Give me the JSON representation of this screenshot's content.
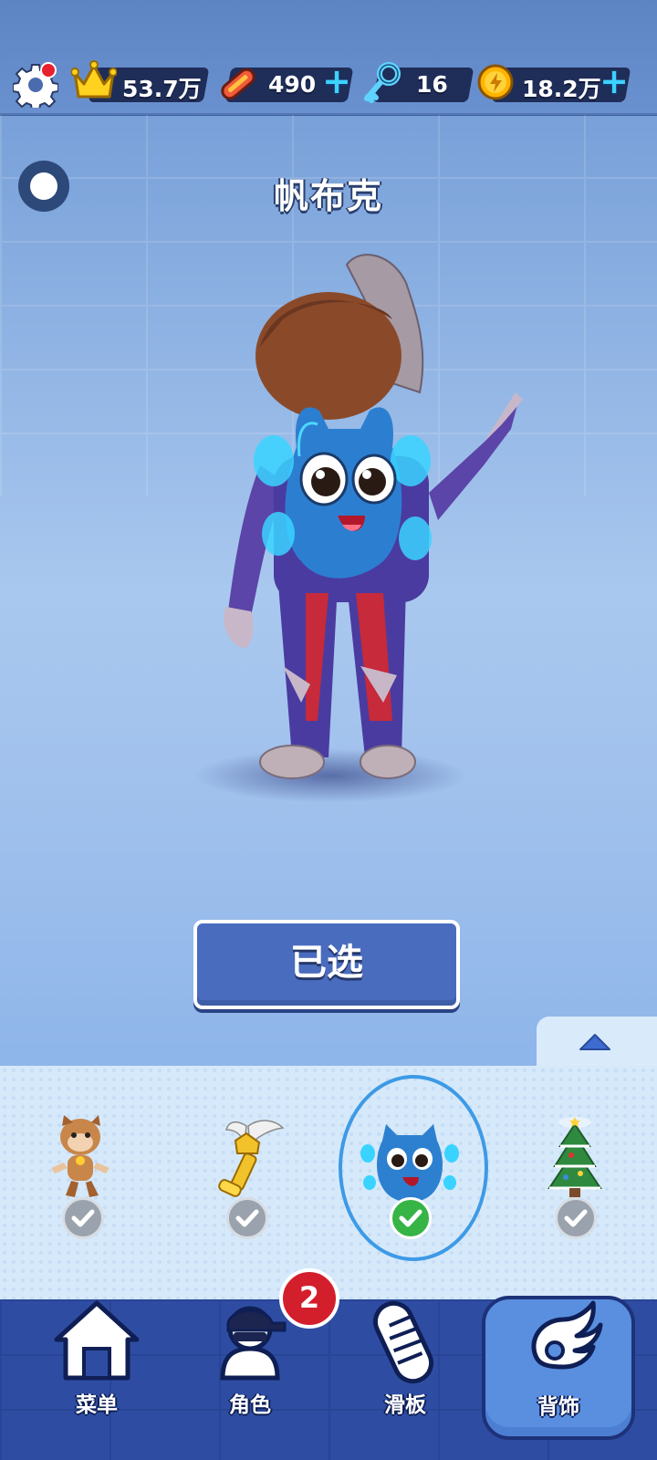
{
  "topbar": {
    "crown_value": "53.7万",
    "board_value": "490",
    "key_value": "16",
    "coin_value": "18.2万",
    "plus_symbol": "+"
  },
  "stage": {
    "title": "帆布克",
    "select_button_label": "已选"
  },
  "tray": {
    "items": [
      {
        "icon": "hamster-pet-icon",
        "selected": false
      },
      {
        "icon": "golden-trophy-icon",
        "selected": false
      },
      {
        "icon": "blue-monster-backpack-icon",
        "selected": true
      },
      {
        "icon": "christmas-tree-icon",
        "selected": false
      }
    ]
  },
  "nav": {
    "tabs": [
      {
        "label": "菜单",
        "icon": "home-icon"
      },
      {
        "label": "角色",
        "icon": "character-icon"
      },
      {
        "label": "滑板",
        "icon": "skateboard-icon"
      },
      {
        "label": "背饰",
        "icon": "wing-icon"
      }
    ],
    "badge_count": "2"
  },
  "colors": {
    "accent_blue": "#3d9ae6",
    "select_button": "#4a6cbe",
    "check_green": "#36b446",
    "badge_red": "#d31f2b"
  }
}
